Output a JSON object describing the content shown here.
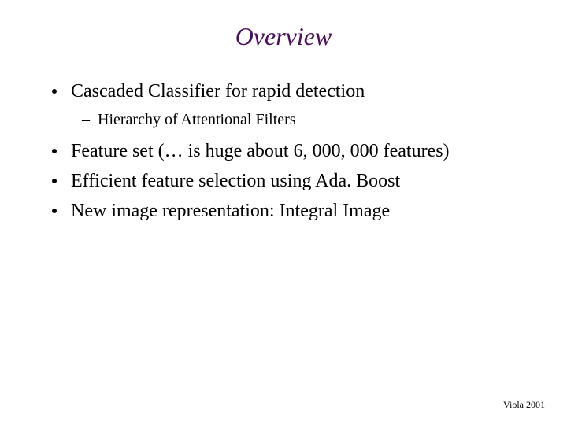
{
  "title": "Overview",
  "bullets": [
    {
      "level": 1,
      "text": "Cascaded Classifier for rapid detection"
    },
    {
      "level": 2,
      "text": "Hierarchy of Attentional Filters"
    },
    {
      "level": 1,
      "text": "Feature set (… is huge about 6, 000, 000 features)"
    },
    {
      "level": 1,
      "text": "Efficient feature selection using Ada. Boost"
    },
    {
      "level": 1,
      "text": "New image representation: Integral Image"
    }
  ],
  "footer": "Viola 2001"
}
